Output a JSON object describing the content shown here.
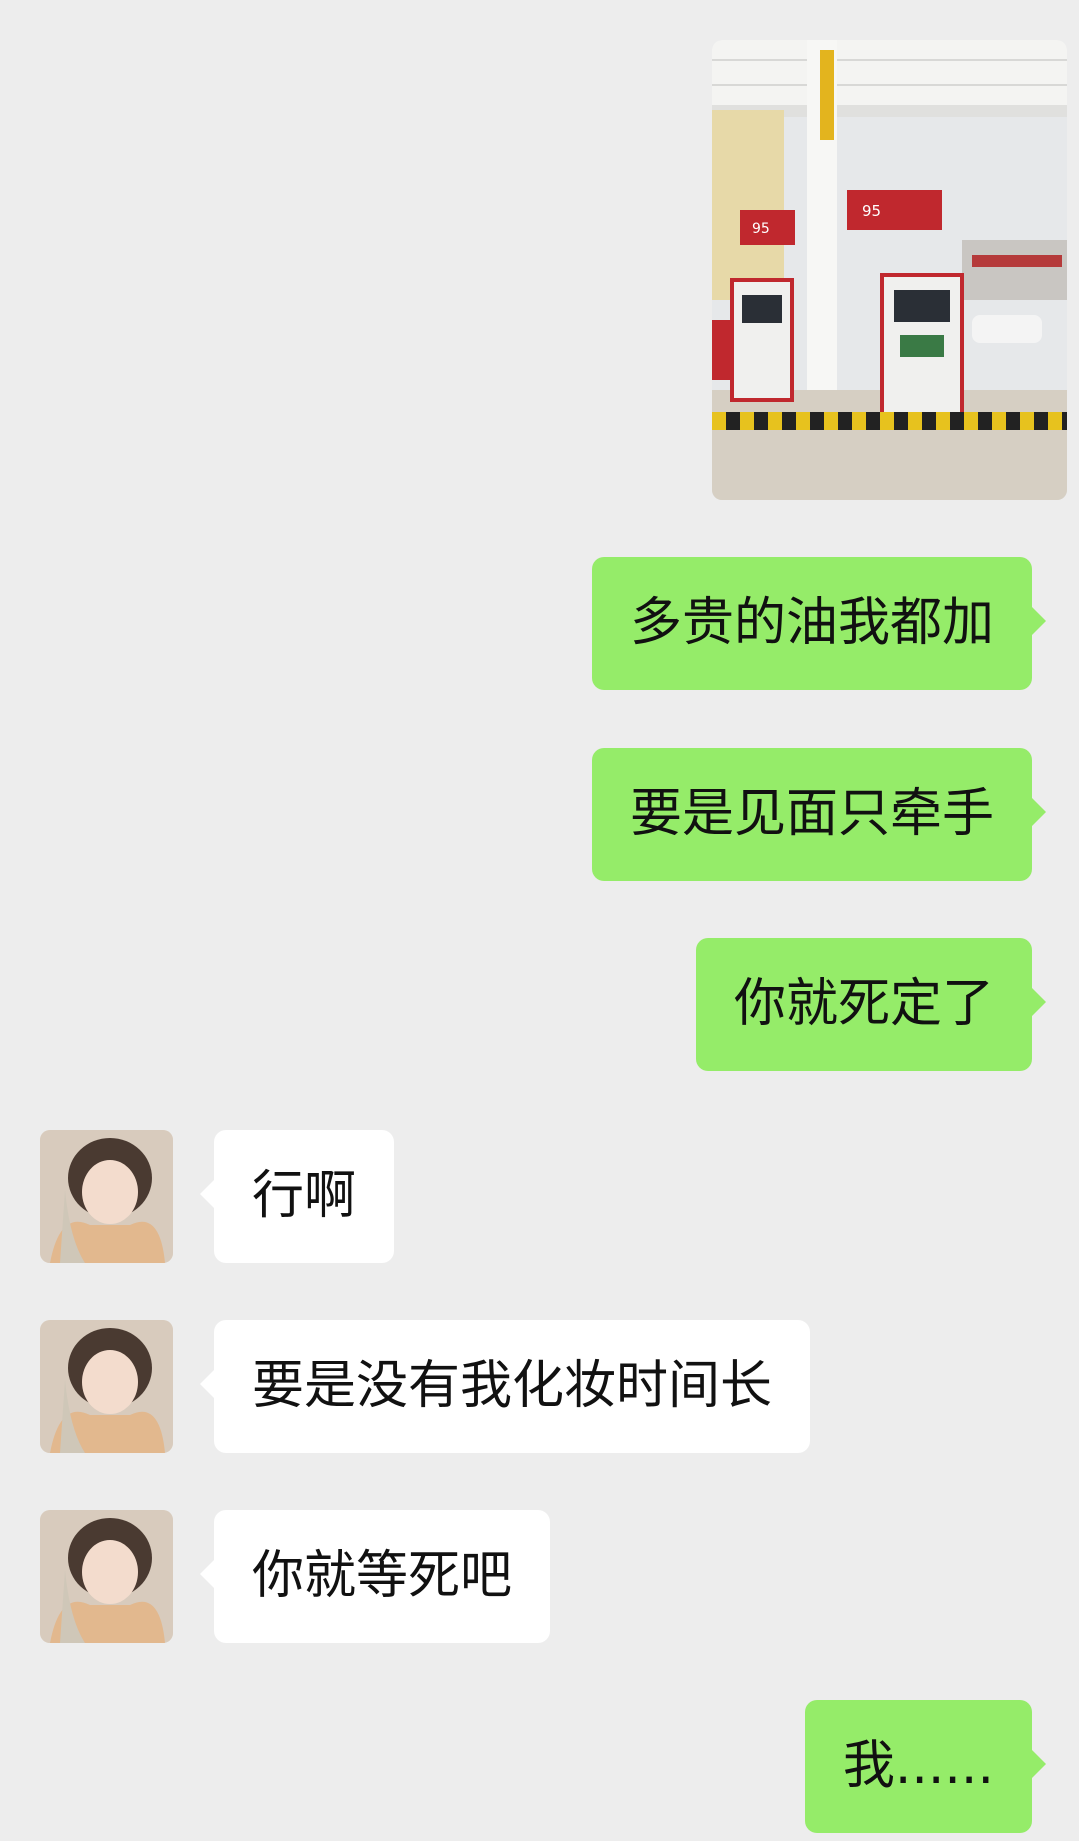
{
  "chat": {
    "outgoing_photo": {
      "alt": "",
      "pump_price_label_left": "95",
      "pump_price_label_right": "95"
    },
    "messages": [
      {
        "side": "out",
        "text": "多贵的油我都加"
      },
      {
        "side": "out",
        "text": "要是见面只牵手"
      },
      {
        "side": "out",
        "text": "你就死定了"
      },
      {
        "side": "in",
        "text": "行啊"
      },
      {
        "side": "in",
        "text": "要是没有我化妆时间长"
      },
      {
        "side": "in",
        "text": "你就等死吧"
      },
      {
        "side": "out",
        "text": "我......"
      }
    ]
  },
  "colors": {
    "background": "#ededed",
    "outgoing_bubble": "#95ec69",
    "incoming_bubble": "#ffffff",
    "text": "#111111"
  }
}
